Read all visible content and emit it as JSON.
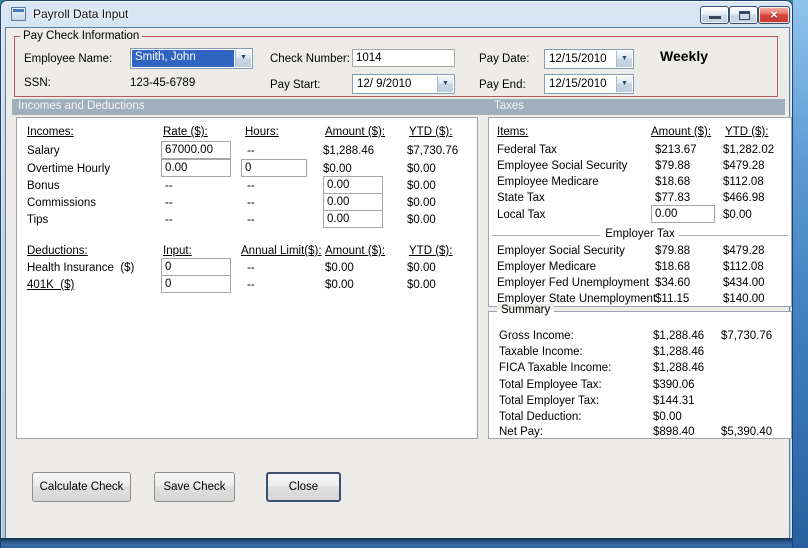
{
  "window": {
    "title": "Payroll Data Input"
  },
  "icons": {
    "dropdown": "▼",
    "close": "×"
  },
  "colors": {
    "paycheck_group_border": "#BA5B5B",
    "section_band_background": "#A1AEBE",
    "selection_blue": "#2F65C0",
    "close_button_red": "#D0443B"
  },
  "paycheck": {
    "group_label": "Pay Check Information",
    "employee_name": {
      "label": "Employee Name:",
      "value": "Smith, John"
    },
    "ssn": {
      "label": "SSN:",
      "value": "123-45-6789"
    },
    "check_number": {
      "label": "Check Number:",
      "value": "1014"
    },
    "pay_start": {
      "label": "Pay Start:",
      "value": "12/ 9/2010"
    },
    "pay_date": {
      "label": "Pay Date:",
      "value": "12/15/2010"
    },
    "pay_end": {
      "label": "Pay End:",
      "value": "12/15/2010"
    },
    "frequency": "Weekly"
  },
  "bands": {
    "incomes": "Incomes and Deductions",
    "taxes": "Taxes"
  },
  "incomes": {
    "headers": {
      "name": "Incomes:",
      "rate": "Rate ($):",
      "hours": "Hours:",
      "amount": "Amount ($):",
      "ytd": "YTD ($):"
    },
    "rows": [
      {
        "label": "Salary",
        "rate": "67000.00",
        "hours": "--",
        "amount": "$1,288.46",
        "ytd": "$7,730.76"
      },
      {
        "label": "Overtime Hourly",
        "rate": "0.00",
        "hours": "0",
        "amount": "$0.00",
        "ytd": "$0.00"
      },
      {
        "label": "Bonus",
        "rate": "--",
        "hours": "--",
        "amount": "0.00",
        "ytd": "$0.00"
      },
      {
        "label": "Commissions",
        "rate": "--",
        "hours": "--",
        "amount": "0.00",
        "ytd": "$0.00"
      },
      {
        "label": "Tips",
        "rate": "--",
        "hours": "--",
        "amount": "0.00",
        "ytd": "$0.00"
      }
    ]
  },
  "deductions": {
    "headers": {
      "name": "Deductions:",
      "input": "Input:",
      "limit": "Annual Limit($):",
      "amount": "Amount ($):",
      "ytd": "YTD ($):"
    },
    "rows": [
      {
        "label": "Health Insurance  ($)",
        "input": "0",
        "limit": "--",
        "amount": "$0.00",
        "ytd": "$0.00"
      },
      {
        "label": "401K  ($)",
        "input": "0",
        "limit": "--",
        "amount": "$0.00",
        "ytd": "$0.00"
      }
    ]
  },
  "taxes": {
    "headers": {
      "name": "Items:",
      "amount": "Amount ($):",
      "ytd": "YTD ($):"
    },
    "employee_rows": [
      {
        "label": "Federal Tax",
        "amount": "$213.67",
        "ytd": "$1,282.02"
      },
      {
        "label": "Employee Social Security",
        "amount": "$79.88",
        "ytd": "$479.28"
      },
      {
        "label": "Employee Medicare",
        "amount": "$18.68",
        "ytd": "$112.08"
      },
      {
        "label": "State Tax",
        "amount": "$77.83",
        "ytd": "$466.98"
      },
      {
        "label": "Local Tax",
        "amount": "0.00",
        "ytd": "$0.00"
      }
    ],
    "employer_group_label": "Employer Tax",
    "employer_rows": [
      {
        "label": "Employer Social Security",
        "amount": "$79.88",
        "ytd": "$479.28"
      },
      {
        "label": "Employer Medicare",
        "amount": "$18.68",
        "ytd": "$112.08"
      },
      {
        "label": "Employer Fed Unemployment",
        "amount": "$34.60",
        "ytd": "$434.00"
      },
      {
        "label": "Employer State Unemployment",
        "amount": "$11.15",
        "ytd": "$140.00"
      }
    ]
  },
  "summary": {
    "group_label": "Summary",
    "rows": [
      {
        "label": "Gross Income:",
        "amount": "$1,288.46",
        "ytd": "$7,730.76"
      },
      {
        "label": "Taxable Income:",
        "amount": "$1,288.46",
        "ytd": ""
      },
      {
        "label": "FICA Taxable Income:",
        "amount": "$1,288.46",
        "ytd": ""
      },
      {
        "label": "Total Employee Tax:",
        "amount": "$390.06",
        "ytd": ""
      },
      {
        "label": "Total Employer Tax:",
        "amount": "$144.31",
        "ytd": ""
      },
      {
        "label": "Total Deduction:",
        "amount": "$0.00",
        "ytd": ""
      },
      {
        "label": "Net Pay:",
        "amount": "$898.40",
        "ytd": "$5,390.40"
      }
    ]
  },
  "buttons": {
    "calculate": "Calculate Check",
    "save": "Save Check",
    "close": "Close"
  }
}
